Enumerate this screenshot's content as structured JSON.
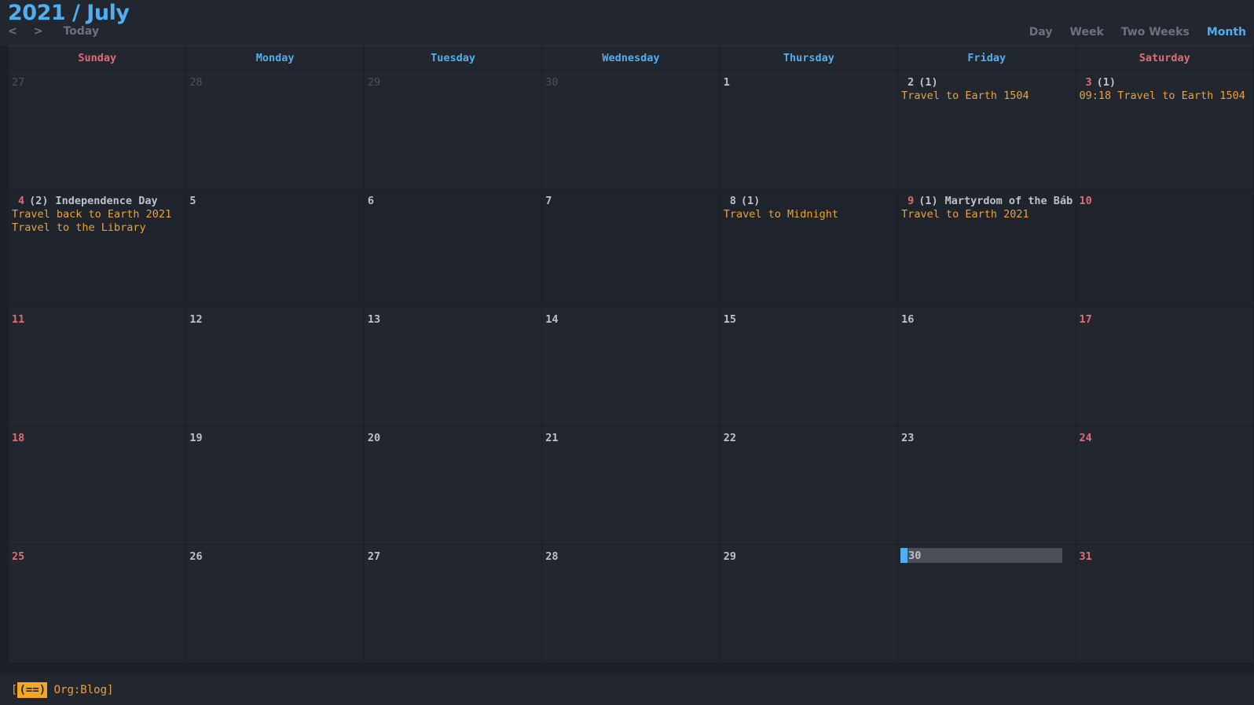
{
  "header": {
    "title": "2021 / July",
    "nav": {
      "prev": "<",
      "next": ">",
      "today": "Today"
    },
    "views": [
      {
        "label": "Day",
        "active": false
      },
      {
        "label": "Week",
        "active": false
      },
      {
        "label": "Two Weeks",
        "active": false
      },
      {
        "label": "Month",
        "active": true
      }
    ]
  },
  "colors": {
    "accent": "#51afef",
    "weekend": "#e06c75",
    "event": "#e8a33d",
    "background": "#1c2028",
    "cell": "#22262e",
    "selection": "#4a4f58"
  },
  "weekdays": [
    {
      "label": "Sunday",
      "weekend": true
    },
    {
      "label": "Monday",
      "weekend": false
    },
    {
      "label": "Tuesday",
      "weekend": false
    },
    {
      "label": "Wednesday",
      "weekend": false
    },
    {
      "label": "Thursday",
      "weekend": false
    },
    {
      "label": "Friday",
      "weekend": false
    },
    {
      "label": "Saturday",
      "weekend": true
    }
  ],
  "weeks": [
    {
      "alt": false,
      "days": [
        {
          "num": "27",
          "style": "dim",
          "meta": "",
          "holiday": "",
          "events": []
        },
        {
          "num": "28",
          "style": "dim",
          "meta": "",
          "holiday": "",
          "events": []
        },
        {
          "num": "29",
          "style": "dim",
          "meta": "",
          "holiday": "",
          "events": []
        },
        {
          "num": "30",
          "style": "dim",
          "meta": "",
          "holiday": "",
          "events": []
        },
        {
          "num": "1",
          "style": "normal",
          "meta": "",
          "holiday": "",
          "events": []
        },
        {
          "num": "2",
          "style": "normal",
          "meta": "(1)",
          "holiday": "",
          "events": [
            "Travel to Earth 1504"
          ]
        },
        {
          "num": "3",
          "style": "red",
          "meta": "(1)",
          "holiday": "",
          "events": [
            "09:18 Travel to Earth 1504"
          ]
        }
      ]
    },
    {
      "alt": true,
      "days": [
        {
          "num": "4",
          "style": "red",
          "meta": "(2)",
          "holiday": "Independence Day",
          "events": [
            "Travel back to Earth 2021",
            "Travel to the Library"
          ]
        },
        {
          "num": "5",
          "style": "normal",
          "meta": "",
          "holiday": "",
          "events": []
        },
        {
          "num": "6",
          "style": "normal",
          "meta": "",
          "holiday": "",
          "events": []
        },
        {
          "num": "7",
          "style": "normal",
          "meta": "",
          "holiday": "",
          "events": []
        },
        {
          "num": "8",
          "style": "normal",
          "meta": "(1)",
          "holiday": "",
          "events": [
            "Travel to Midnight"
          ]
        },
        {
          "num": "9",
          "style": "red",
          "meta": "(1)",
          "holiday": "Martyrdom of the Báb",
          "events": [
            "Travel to Earth 2021"
          ]
        },
        {
          "num": "10",
          "style": "red",
          "meta": "",
          "holiday": "",
          "events": []
        }
      ]
    },
    {
      "alt": false,
      "days": [
        {
          "num": "11",
          "style": "red",
          "meta": "",
          "holiday": "",
          "events": []
        },
        {
          "num": "12",
          "style": "normal",
          "meta": "",
          "holiday": "",
          "events": []
        },
        {
          "num": "13",
          "style": "normal",
          "meta": "",
          "holiday": "",
          "events": []
        },
        {
          "num": "14",
          "style": "normal",
          "meta": "",
          "holiday": "",
          "events": []
        },
        {
          "num": "15",
          "style": "normal",
          "meta": "",
          "holiday": "",
          "events": []
        },
        {
          "num": "16",
          "style": "normal",
          "meta": "",
          "holiday": "",
          "events": []
        },
        {
          "num": "17",
          "style": "red",
          "meta": "",
          "holiday": "",
          "events": []
        }
      ]
    },
    {
      "alt": false,
      "days": [
        {
          "num": "18",
          "style": "red",
          "meta": "",
          "holiday": "",
          "events": []
        },
        {
          "num": "19",
          "style": "normal",
          "meta": "",
          "holiday": "",
          "events": []
        },
        {
          "num": "20",
          "style": "normal",
          "meta": "",
          "holiday": "",
          "events": []
        },
        {
          "num": "21",
          "style": "normal",
          "meta": "",
          "holiday": "",
          "events": []
        },
        {
          "num": "22",
          "style": "normal",
          "meta": "",
          "holiday": "",
          "events": []
        },
        {
          "num": "23",
          "style": "normal",
          "meta": "",
          "holiday": "",
          "events": []
        },
        {
          "num": "24",
          "style": "red",
          "meta": "",
          "holiday": "",
          "events": []
        }
      ]
    },
    {
      "alt": false,
      "days": [
        {
          "num": "25",
          "style": "red",
          "meta": "",
          "holiday": "",
          "events": []
        },
        {
          "num": "26",
          "style": "normal",
          "meta": "",
          "holiday": "",
          "events": []
        },
        {
          "num": "27",
          "style": "normal",
          "meta": "",
          "holiday": "",
          "events": []
        },
        {
          "num": "28",
          "style": "normal",
          "meta": "",
          "holiday": "",
          "events": []
        },
        {
          "num": "29",
          "style": "normal",
          "meta": "",
          "holiday": "",
          "events": []
        },
        {
          "num": "30",
          "style": "selected",
          "meta": "",
          "holiday": "",
          "events": []
        },
        {
          "num": "31",
          "style": "red",
          "meta": "",
          "holiday": "",
          "events": []
        }
      ]
    }
  ],
  "statusbar": {
    "open_bracket": "[",
    "badge": "(==)",
    "text": " Org:Blog]"
  }
}
